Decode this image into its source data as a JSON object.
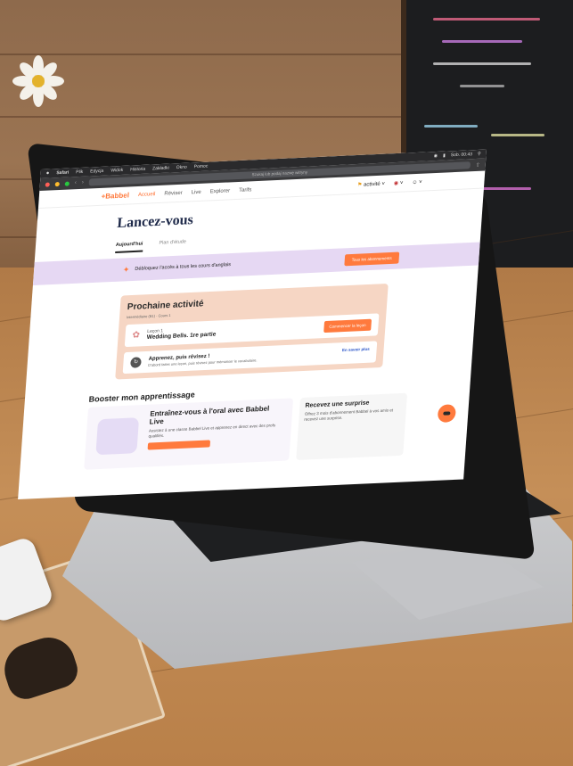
{
  "browser": {
    "menu": [
      "Safari",
      "Plik",
      "Edycja",
      "Widok",
      "Historia",
      "Zakładki",
      "Okno",
      "Pomoc"
    ],
    "url_placeholder": "Szukaj lub podaj nazwę witryny",
    "clock": "Sob. 00:43"
  },
  "nav": {
    "logo": "+Babbel",
    "items": [
      "Accueil",
      "Réviser",
      "Live",
      "Explorer",
      "Tarifs"
    ],
    "active_index": 0,
    "activity": "activité",
    "accent": "#ff7a3d"
  },
  "page": {
    "title": "Lancez-vous",
    "tabs": [
      "Aujourd'hui",
      "Plan d'étude"
    ],
    "active_tab": 0
  },
  "banner": {
    "text": "Débloquez l'accès à tous les cours d'anglais",
    "button": "Tous les abonnements",
    "bg": "#e6d8f3"
  },
  "activity": {
    "title": "Prochaine activité",
    "level": "Intermédiaire (B1) · Cours 1",
    "lesson_small": "Leçon 1",
    "lesson_name": "Wedding Bells. 1re partie",
    "lesson_button": "Commencer la leçon",
    "tip_title": "Apprenez, puis révisez !",
    "tip_text": "D'abord faites une leçon, puis révisez pour mémoriser le vocabulaire.",
    "tip_link": "En savoir plus"
  },
  "boost": {
    "section_title": "Booster mon apprentissage",
    "live_title": "Entraînez-vous à l'oral avec Babbel Live",
    "live_text": "Assistez à une classe Babbel Live et apprenez en direct avec des profs qualifiés.",
    "gift_title": "Recevez une surprise",
    "gift_text": "Offrez 3 mois d'abonnement Babbel à vos amis et recevez une surprise."
  }
}
